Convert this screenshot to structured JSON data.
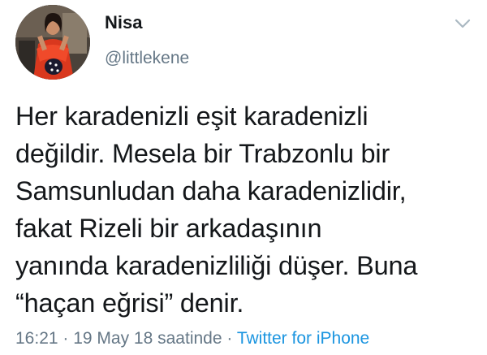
{
  "tweet": {
    "display_name": "Nisa",
    "handle": "@littlekene",
    "text_lines": [
      "Her karadenizli eşit karadenizli",
      "değildir. Mesela bir Trabzonlu bir",
      "Samsunludan daha karadenizlidir,",
      "fakat Rizeli bir arkadaşının",
      "yanında karadenizliliği düşer. Buna",
      "“haçan eğrisi” denir."
    ],
    "time": "16:21",
    "separator": " · ",
    "date": "19 May 18 saatinde",
    "source": "Twitter for iPhone"
  },
  "icons": {
    "menu": "chevron-down-icon",
    "avatar": "profile-photo"
  },
  "colors": {
    "text": "#14171a",
    "secondary": "#657786",
    "link": "#1b95e0"
  }
}
